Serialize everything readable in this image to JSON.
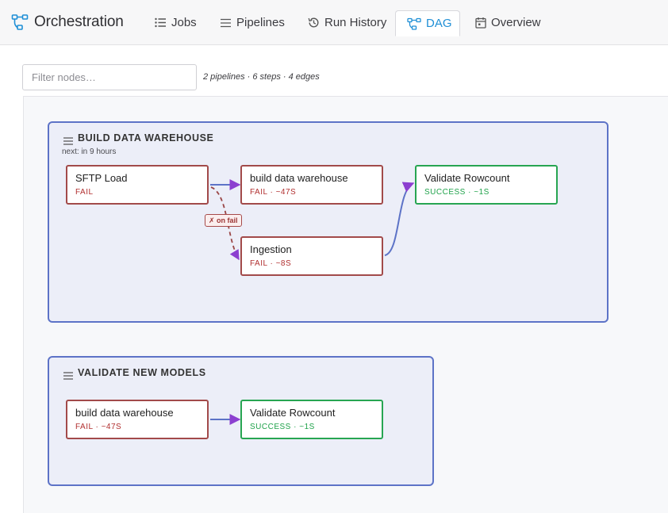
{
  "app": {
    "title": "Orchestration"
  },
  "tabs": [
    {
      "label": "Jobs",
      "icon": "list-icon"
    },
    {
      "label": "Pipelines",
      "icon": "lines-icon"
    },
    {
      "label": "Run History",
      "icon": "history-icon"
    },
    {
      "label": "DAG",
      "icon": "dag-icon",
      "active": true
    },
    {
      "label": "Overview",
      "icon": "calendar-icon"
    }
  ],
  "filter": {
    "placeholder": "Filter nodes…",
    "value": ""
  },
  "summary": "2 pipelines · 6 steps · 4 edges",
  "colors": {
    "accent": "#1f8fd6",
    "fail": "#a24a4a",
    "success": "#27a552",
    "group_border": "#5d73c7",
    "edge": "#5d73c7",
    "arrow": "#8c3fd0"
  },
  "groups": [
    {
      "title": "BUILD DATA WAREHOUSE",
      "next": "next: in 9 hours",
      "nodes": [
        {
          "name": "SFTP Load",
          "status": "FAIL"
        },
        {
          "name": "build data warehouse",
          "status": "FAIL · ~47S"
        },
        {
          "name": "Validate Rowcount",
          "status": "SUCCESS · ~1S"
        },
        {
          "name": "Ingestion",
          "status": "FAIL · ~8S"
        }
      ],
      "edge_label": "✗ on fail"
    },
    {
      "title": "VALIDATE NEW MODELS",
      "nodes": [
        {
          "name": "build data warehouse",
          "status": "FAIL · ~47S"
        },
        {
          "name": "Validate Rowcount",
          "status": "SUCCESS · ~1S"
        }
      ]
    }
  ]
}
